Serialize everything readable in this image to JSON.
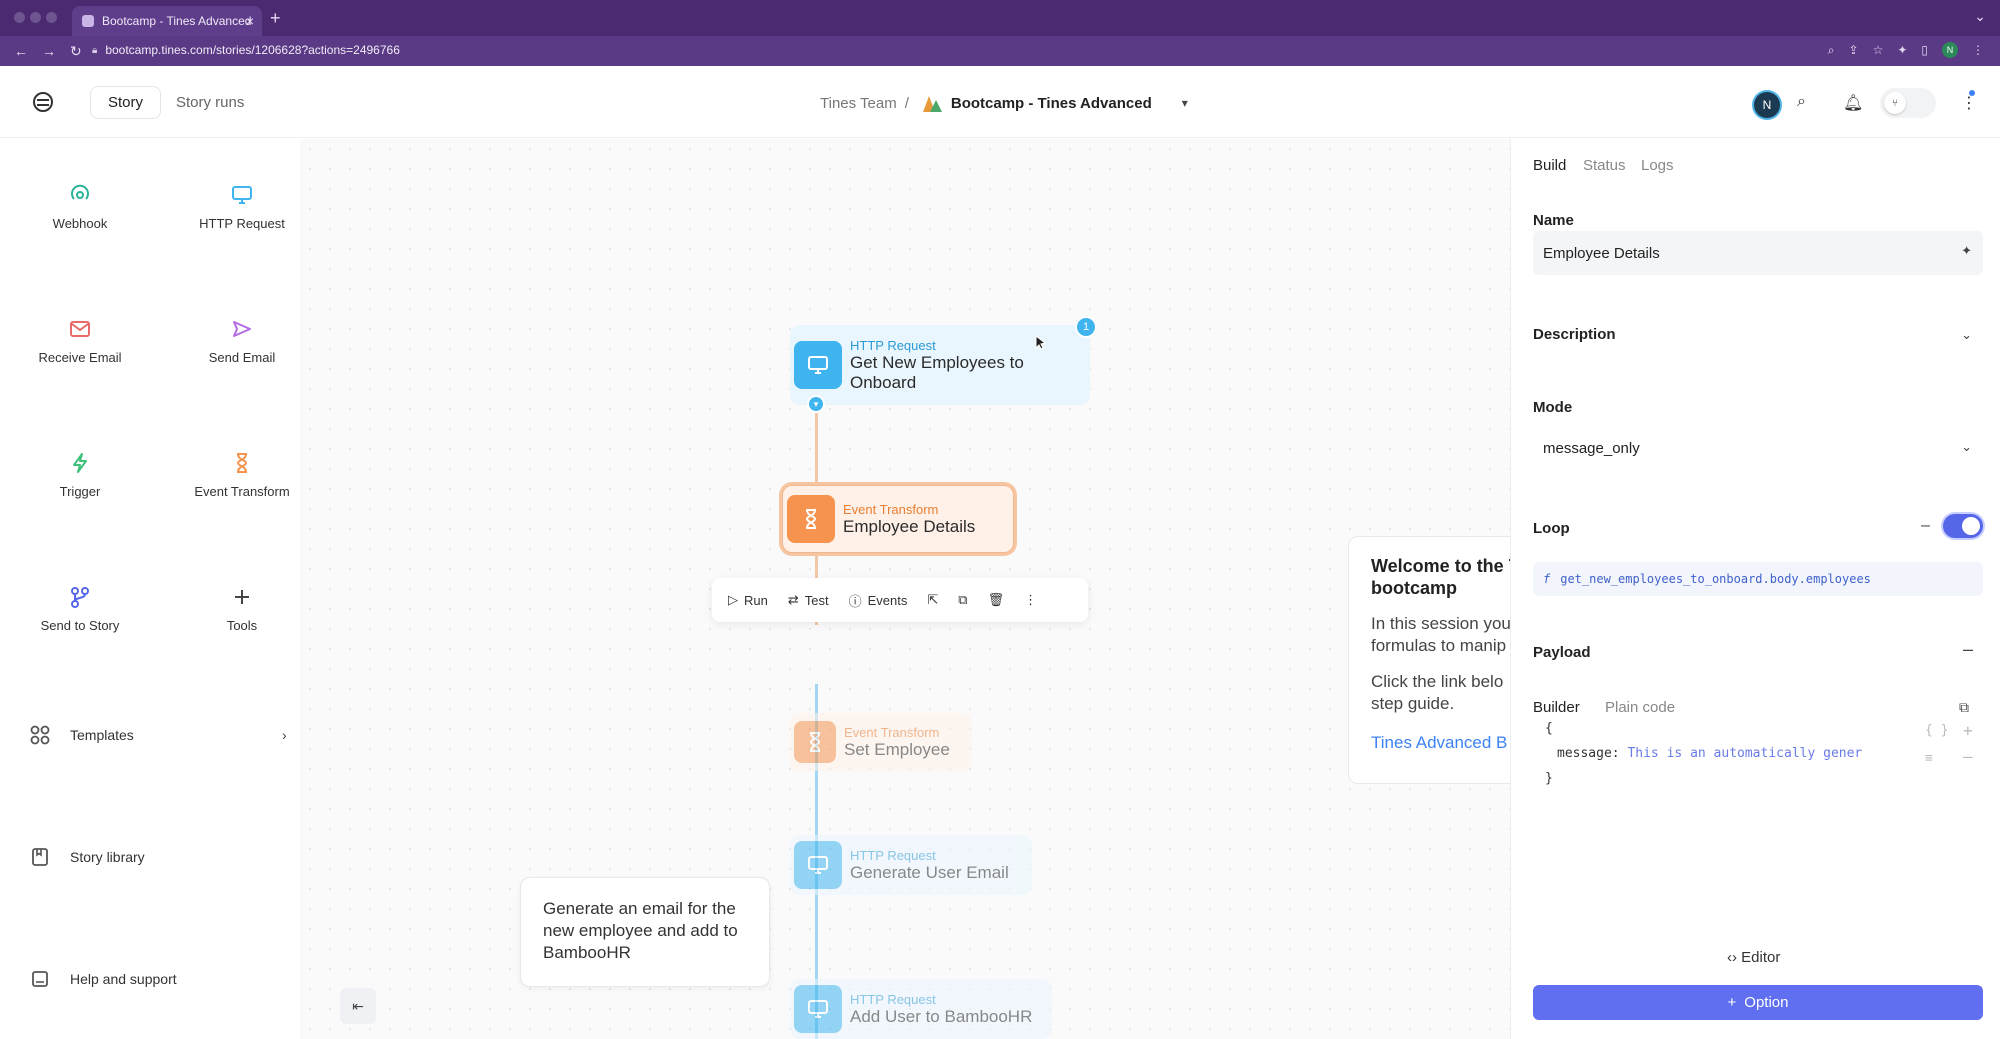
{
  "browser": {
    "tab_title": "Bootcamp - Tines Advanced",
    "tab_close": "×",
    "new_tab": "+",
    "url": "bootcamp.tines.com/stories/1206628?actions=2496766",
    "profile_initial": "N"
  },
  "header": {
    "story_tab": "Story",
    "story_runs_tab": "Story runs",
    "team": "Tines Team",
    "separator": "/",
    "story_title": "Bootcamp - Tines Advanced",
    "user_initial": "N"
  },
  "sidebar": {
    "tools": [
      {
        "label": "Webhook",
        "icon": "webhook-icon",
        "color": "#29b59a"
      },
      {
        "label": "HTTP Request",
        "icon": "monitor-icon",
        "color": "#40b4ee"
      },
      {
        "label": "Receive Email",
        "icon": "envelope-icon",
        "color": "#e86a6a"
      },
      {
        "label": "Send Email",
        "icon": "send-icon",
        "color": "#b46be6"
      },
      {
        "label": "Trigger",
        "icon": "bolt-icon",
        "color": "#3cc07a"
      },
      {
        "label": "Event Transform",
        "icon": "hourglass-icon",
        "color": "#f5934f"
      },
      {
        "label": "Send to Story",
        "icon": "branch-icon",
        "color": "#5567e8"
      },
      {
        "label": "Tools",
        "icon": "plus-icon",
        "color": "#444444"
      }
    ],
    "links": {
      "templates": "Templates",
      "story_library": "Story library",
      "help": "Help and support"
    }
  },
  "canvas": {
    "nodes": [
      {
        "type": "HTTP Request",
        "name": "Get New Employees to Onboard",
        "badge": "1"
      },
      {
        "type": "Event Transform",
        "name": "Employee Details"
      },
      {
        "type": "Event Transform",
        "name": "Set Employee"
      },
      {
        "type": "HTTP Request",
        "name": "Generate User Email"
      },
      {
        "type": "HTTP Request",
        "name": "Add User to BambooHR"
      }
    ],
    "toolbar": {
      "run": "Run",
      "test": "Test",
      "events": "Events"
    },
    "note": "Generate an email for the new employee and add to BambooHR",
    "welcome": {
      "title_line1": "Welcome to the T",
      "title_line2": "bootcamp",
      "para1_line1": "In this session you",
      "para1_line2": "formulas to manip",
      "para2_line1": "Click the link belo",
      "para2_line2": "step guide.",
      "link": "Tines Advanced B"
    }
  },
  "panel": {
    "tabs": {
      "build": "Build",
      "status": "Status",
      "logs": "Logs"
    },
    "name_label": "Name",
    "name_value": "Employee Details",
    "description_label": "Description",
    "mode_label": "Mode",
    "mode_value": "message_only",
    "loop_label": "Loop",
    "loop_value": "get_new_employees_to_onboard.body.employees",
    "loop_fx": "f",
    "payload_label": "Payload",
    "builder_tab": "Builder",
    "plain_code_tab": "Plain code",
    "code_open": "{",
    "code_key": "message:",
    "code_value": "This is an automatically gener",
    "code_close": "}",
    "editor_label": "Editor",
    "option_label": "Option"
  },
  "colors": {
    "accent": "#5f6ff0",
    "browser": "#4b2a72",
    "http": "#40b4ee",
    "transform": "#f5934f"
  }
}
